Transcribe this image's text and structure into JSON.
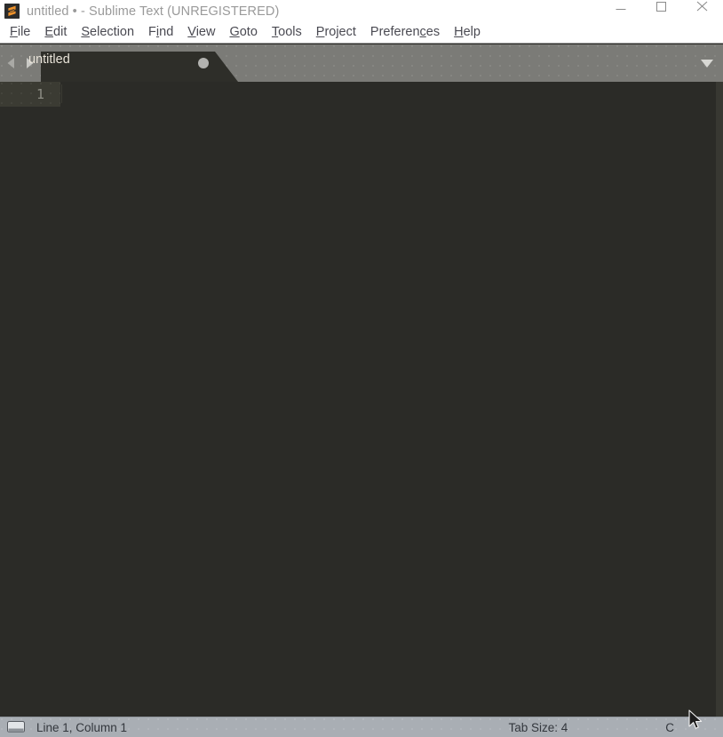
{
  "window": {
    "title": "untitled • - Sublime Text (UNREGISTERED)",
    "app_icon": "sublime-text-logo-icon",
    "controls": {
      "minimize_label": "Minimize",
      "maximize_label": "Maximize",
      "close_label": "Close"
    }
  },
  "menubar": {
    "items": [
      {
        "label": "File",
        "accel_index": 0
      },
      {
        "label": "Edit",
        "accel_index": 0
      },
      {
        "label": "Selection",
        "accel_index": 0
      },
      {
        "label": "Find",
        "accel_index": 1
      },
      {
        "label": "View",
        "accel_index": 0
      },
      {
        "label": "Goto",
        "accel_index": 0
      },
      {
        "label": "Tools",
        "accel_index": 0
      },
      {
        "label": "Project",
        "accel_index": 0
      },
      {
        "label": "Preferences",
        "accel_index": 8
      },
      {
        "label": "Help",
        "accel_index": 0
      }
    ]
  },
  "tabbar": {
    "nav_back_label": "Previous tab",
    "nav_forward_label": "Next tab",
    "tabs": [
      {
        "label": "untitled",
        "modified": true,
        "active": true
      }
    ],
    "menu_label": "Tab list menu"
  },
  "editor": {
    "line_numbers": [
      "1"
    ],
    "content": "",
    "cursor_line": 1,
    "cursor_column": 1
  },
  "statusbar": {
    "icon": "monitor-icon",
    "position": "Line 1, Column 1",
    "tab_size": "Tab Size: 4",
    "syntax": "C"
  },
  "colors": {
    "titlebar_bg": "#ffffff",
    "titlebar_text": "#9a9a9a",
    "menubar_bg": "#ffffff",
    "menubar_text": "#4a4a52",
    "tabbar_bg": "#7b7b77",
    "tab_active_bg": "#2e2e29",
    "tab_label": "#e8e3d8",
    "editor_bg": "#2b2b27",
    "gutter_active_bg": "#3b3b33",
    "line_number": "#8d8d84",
    "statusbar_bg": "#a9aeb4",
    "statusbar_text": "#33373d",
    "logo_orange": "#f0932b"
  }
}
